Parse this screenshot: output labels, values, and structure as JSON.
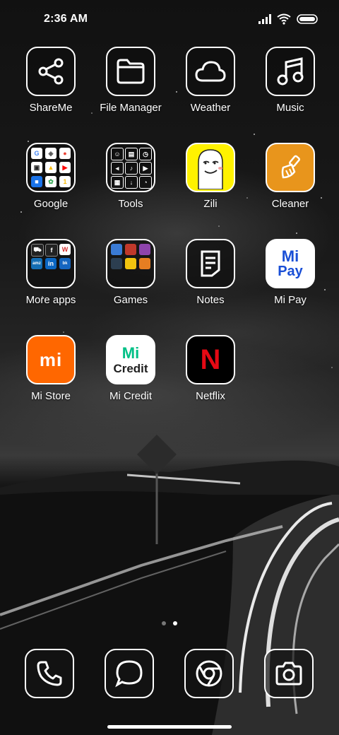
{
  "status_bar": {
    "time": "2:36 AM",
    "icons": [
      "signal-icon",
      "wifi-icon",
      "battery-icon"
    ]
  },
  "apps": [
    {
      "label": "ShareMe",
      "icon": "share-icon"
    },
    {
      "label": "File Manager",
      "icon": "folder-icon"
    },
    {
      "label": "Weather",
      "icon": "cloud-icon"
    },
    {
      "label": "Music",
      "icon": "music-note-icon"
    },
    {
      "label": "Google",
      "icon": "folder-google-icon"
    },
    {
      "label": "Tools",
      "icon": "folder-tools-icon"
    },
    {
      "label": "Zili",
      "icon": "zili-face-icon"
    },
    {
      "label": "Cleaner",
      "icon": "broom-icon"
    },
    {
      "label": "More apps",
      "icon": "folder-more-apps-icon"
    },
    {
      "label": "Games",
      "icon": "folder-games-icon"
    },
    {
      "label": "Notes",
      "icon": "note-icon"
    },
    {
      "label": "Mi Pay",
      "icon": "mi-pay-logo-icon",
      "logo_text": [
        "Mi",
        "Pay"
      ]
    },
    {
      "label": "Mi Store",
      "icon": "mi-logo-icon",
      "logo_text": "mi"
    },
    {
      "label": "Mi Credit",
      "icon": "mi-credit-logo-icon",
      "logo_text": [
        "Mi",
        "Credit"
      ]
    },
    {
      "label": "Netflix",
      "icon": "netflix-n-icon",
      "logo_text": "N"
    }
  ],
  "folder_mini_icons": {
    "google": [
      "G",
      "maps",
      "drive",
      "youtube",
      "duo",
      "photos"
    ],
    "more_apps": [
      "W"
    ]
  },
  "dock": [
    {
      "name": "phone",
      "icon": "phone-icon"
    },
    {
      "name": "messages",
      "icon": "message-icon"
    },
    {
      "name": "browser",
      "icon": "chrome-icon"
    },
    {
      "name": "camera",
      "icon": "camera-icon"
    }
  ],
  "page_indicator": {
    "pages": 2,
    "current": 2
  },
  "colors": {
    "cleaner_orange": "#E8951C",
    "mi_store_orange": "#FF6700",
    "netflix_red": "#E50914",
    "zili_yellow": "#FFF200",
    "mi_green": "#00C086",
    "mi_pay_blue": "#1A4FD6"
  }
}
